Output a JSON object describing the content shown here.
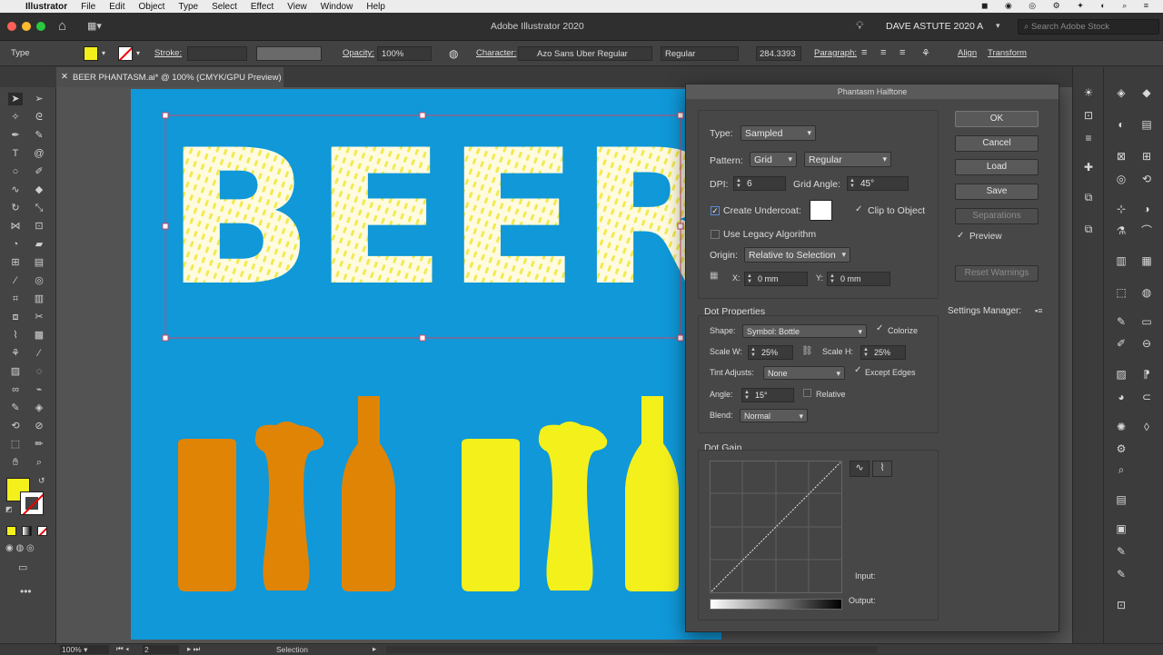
{
  "menubar": {
    "app": "Illustrator",
    "items": [
      "File",
      "Edit",
      "Object",
      "Type",
      "Select",
      "Effect",
      "View",
      "Window",
      "Help"
    ]
  },
  "apptitle": {
    "title": "Adobe Illustrator 2020",
    "workspace": "DAVE ASTUTE 2020 A",
    "search_placeholder": "Search Adobe Stock"
  },
  "control": {
    "selection": "Type",
    "stroke_label": "Stroke:",
    "opacity_label": "Opacity:",
    "opacity_value": "100%",
    "character_label": "Character:",
    "font": "Azo Sans Uber Regular",
    "style": "Regular",
    "size": "284.3393",
    "paragraph_label": "Paragraph:",
    "align": "Align",
    "transform": "Transform"
  },
  "doc": {
    "tab": "BEER PHANTASM.ai* @ 100% (CMYK/GPU Preview)"
  },
  "artboard": {
    "text": "BEER",
    "colors": {
      "bg": "#1098d8",
      "orange": "#e08406",
      "yellow": "#f4f01c"
    }
  },
  "dialog": {
    "title": "Phantasm Halftone",
    "type_label": "Type:",
    "type_value": "Sampled",
    "pattern_label": "Pattern:",
    "pattern_value": "Grid",
    "pattern_style": "Regular",
    "dpi_label": "DPI:",
    "dpi_value": "6",
    "grid_angle_label": "Grid Angle:",
    "grid_angle_value": "45°",
    "undercoat_label": "Create Undercoat:",
    "clip_label": "Clip to Object",
    "legacy_label": "Use Legacy Algorithm",
    "origin_label": "Origin:",
    "origin_value": "Relative to Selection",
    "x_label": "X:",
    "x_value": "0 mm",
    "y_label": "Y:",
    "y_value": "0 mm",
    "dot_props": "Dot Properties",
    "shape_label": "Shape:",
    "shape_value": "Symbol: Bottle",
    "colorize": "Colorize",
    "scalew_label": "Scale W:",
    "scalew_value": "25%",
    "scaleh_label": "Scale H:",
    "scaleh_value": "25%",
    "tint_label": "Tint Adjusts:",
    "tint_value": "None",
    "except_edges": "Except Edges",
    "angle_label": "Angle:",
    "angle_value": "15°",
    "relative": "Relative",
    "blend_label": "Blend:",
    "blend_value": "Normal",
    "dot_gain": "Dot Gain",
    "input_label": "Input:",
    "output_label": "Output:",
    "settings": "Settings Manager:",
    "buttons": {
      "ok": "OK",
      "cancel": "Cancel",
      "load": "Load",
      "save": "Save",
      "separations": "Separations",
      "reset": "Reset Warnings"
    },
    "preview": "Preview"
  },
  "status": {
    "zoom": "100%",
    "page": "2",
    "tool": "Selection"
  }
}
